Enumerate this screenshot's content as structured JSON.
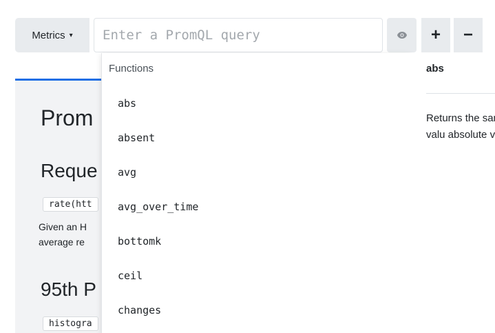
{
  "toolbar": {
    "metrics_label": "Metrics",
    "metrics_caret": "▾",
    "query_placeholder": "Enter a PromQL query",
    "query_value": "",
    "plus_label": "+",
    "minus_label": "−"
  },
  "background": {
    "title": "Prom",
    "section1_title": "Reque",
    "section1_code": "rate(htt",
    "section1_desc_line1": "Given an H",
    "section1_desc_line2": "average re",
    "section2_title": "95th P",
    "section2_code": "histogra"
  },
  "autocomplete": {
    "header": "Functions",
    "items": [
      "abs",
      "absent",
      "avg",
      "avg_over_time",
      "bottomk",
      "ceil",
      "changes"
    ]
  },
  "info_panel": {
    "title": "abs",
    "description": "Returns the sample valu absolute val"
  },
  "colors": {
    "accent": "#1f6fe5",
    "button_bg": "#e8ebee",
    "panel_bg": "#f2f3f5"
  },
  "icons": {
    "metrics_caret": "caret-down-icon",
    "visibility": "eye-icon",
    "add": "plus-icon",
    "remove": "minus-icon"
  }
}
